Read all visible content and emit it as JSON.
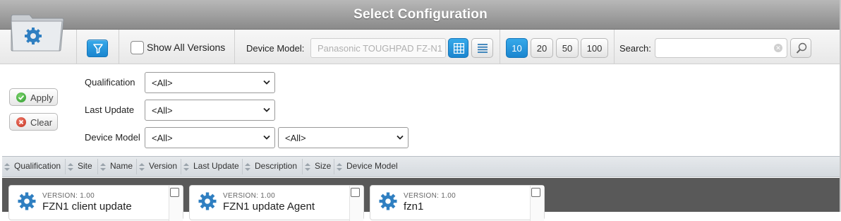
{
  "window": {
    "title": "Select Configuration"
  },
  "toolbar": {
    "show_all_versions_label": "Show All Versions",
    "device_model_label": "Device Model:",
    "device_model_value": "Panasonic TOUGHPAD FZ-N1",
    "page_sizes": [
      "10",
      "20",
      "50",
      "100"
    ],
    "active_page_size": "10",
    "search_label": "Search:",
    "search_value": ""
  },
  "filters": {
    "apply_label": "Apply",
    "clear_label": "Clear",
    "rows": [
      {
        "label": "Qualification",
        "value": "<All>"
      },
      {
        "label": "Last Update",
        "value": "<All>"
      },
      {
        "label": "Device Model",
        "value": "<All>",
        "value2": "<All>"
      }
    ]
  },
  "columns": [
    "Qualification",
    "Site",
    "Name",
    "Version",
    "Last Update",
    "Description",
    "Size",
    "Device Model"
  ],
  "cards": [
    {
      "version": "VERSION: 1.00",
      "name": "FZN1 client update"
    },
    {
      "version": "VERSION: 1.00",
      "name": "FZN1 update Agent"
    },
    {
      "version": "VERSION: 1.00",
      "name": "fzn1"
    }
  ],
  "colors": {
    "accent": "#1b86cf",
    "titlebar": "#9a9a9a",
    "grid_bg": "#595959"
  }
}
